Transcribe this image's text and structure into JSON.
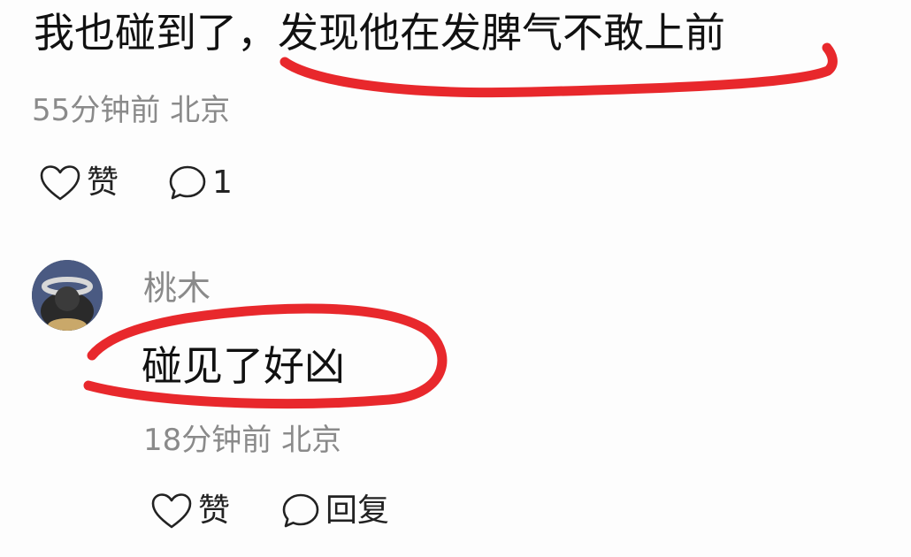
{
  "comment": {
    "text": "我也碰到了，发现他在发脾气不敢上前",
    "meta": "55分钟前 北京",
    "like_label": "赞",
    "comment_count": "1"
  },
  "reply": {
    "username": "桃木",
    "text": "碰见了好凶",
    "meta": "18分钟前 北京",
    "like_label": "赞",
    "reply_label": "回复"
  },
  "colors": {
    "annotation": "#e8282c",
    "meta_text": "#8a8a8a",
    "body_text": "#111111"
  },
  "icons": [
    "heart-icon",
    "comment-bubble-icon"
  ]
}
